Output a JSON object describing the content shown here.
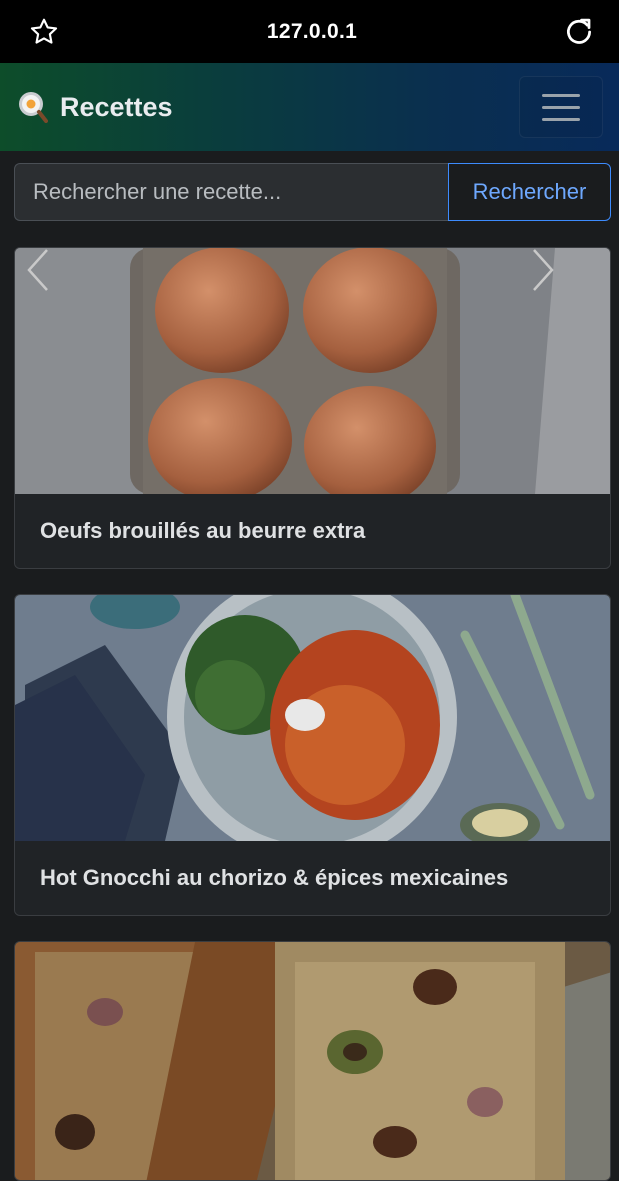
{
  "browser": {
    "url": "127.0.0.1",
    "bookmark_icon": "star-icon",
    "reload_icon": "reload-icon"
  },
  "navbar": {
    "brand_title": "Recettes",
    "brand_icon": "frying-pan-egg-icon",
    "toggle_icon": "hamburger-menu-icon"
  },
  "search": {
    "placeholder": "Rechercher une recette...",
    "button_label": "Rechercher"
  },
  "recipes": [
    {
      "title": "Oeufs brouillés au beurre extra"
    },
    {
      "title": "Hot Gnocchi au chorizo & épices mexicaines"
    },
    {
      "title": ""
    }
  ],
  "colors": {
    "accent": "#3d8bfd",
    "background": "#1a1c1e",
    "card": "#2b2e31"
  }
}
